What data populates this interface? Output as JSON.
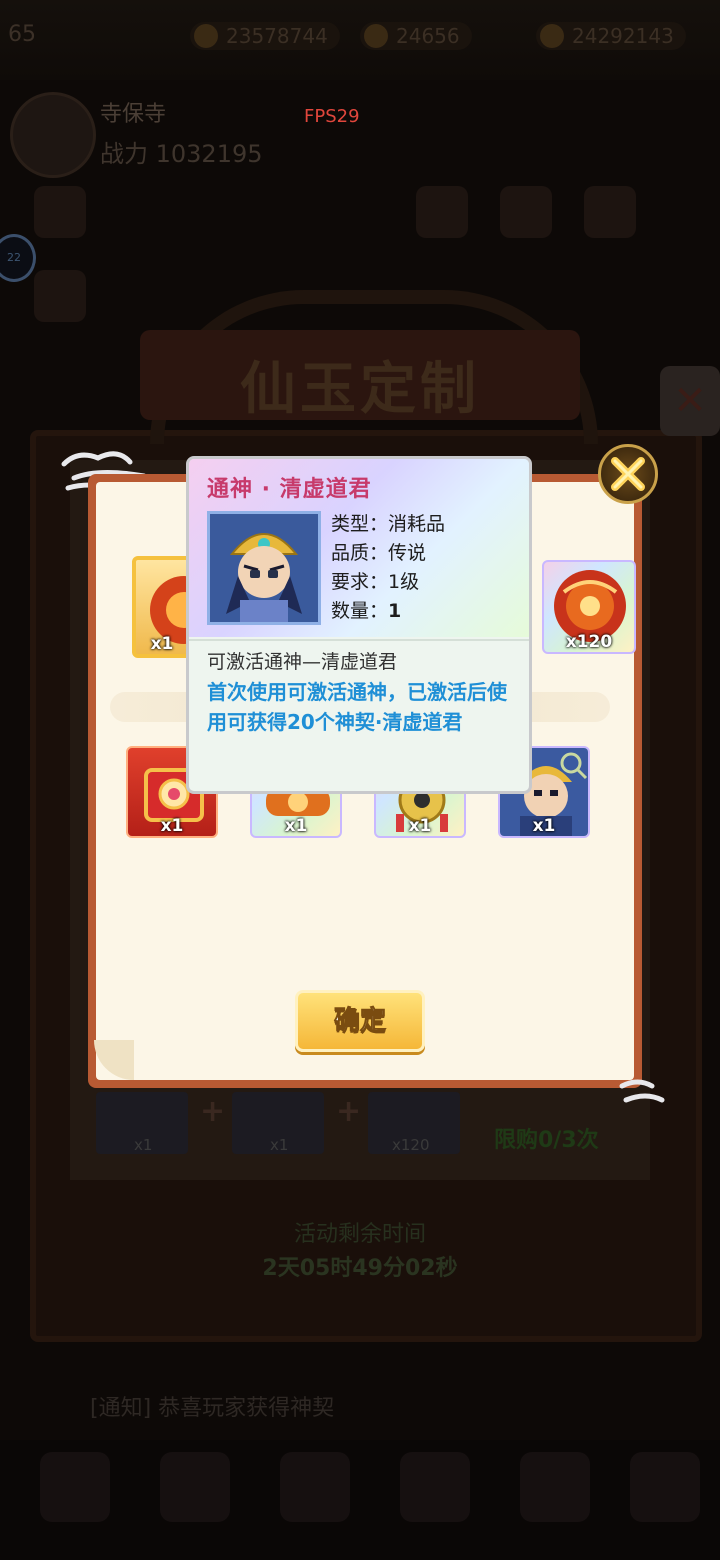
{
  "hud": {
    "level": "65",
    "currency": [
      "23578744",
      "24656",
      "24292143"
    ],
    "player_name": "寺保寺",
    "player_power": "战力 1032195",
    "fps": "FPS29",
    "side_badge": "22"
  },
  "background": {
    "event_title": "仙玉定制",
    "close_glyph": "✕",
    "purchase_limit": "限购0/3次",
    "remaining_label": "活动剩余时间",
    "remaining_time": "2天05时49分02秒",
    "bottom_slots": [
      "x1",
      "x1",
      "x120"
    ],
    "ticker": "[通知] 恭喜玩家获得神契"
  },
  "reward_panel": {
    "top_items": [
      {
        "icon": "selected-reward-icon",
        "qty": "x1"
      },
      {
        "icon": "fire-orb-icon",
        "qty": "x120"
      }
    ],
    "bottom_items": [
      {
        "icon": "red-gift-box-icon",
        "qty": "x1"
      },
      {
        "icon": "fire-scroll-icon",
        "qty": "x1"
      },
      {
        "icon": "golden-ornament-icon",
        "qty": "x1"
      },
      {
        "icon": "hero-portrait-icon",
        "qty": "x1"
      }
    ],
    "confirm_label": "确定"
  },
  "tooltip": {
    "title": "通神 · 清虚道君",
    "type_label": "类型：",
    "type_value": "消耗品",
    "quality_label": "品质：",
    "quality_value": "传说",
    "req_label": "要求：",
    "req_value": "1级",
    "count_label": "数量：",
    "count_value": "1",
    "desc_plain": "可激活通神—清虚道君",
    "desc_effect": "首次使用可激活通神，已激活后使用可获得20个神契·清虚道君"
  },
  "colors": {
    "title_pink": "#c73a6b",
    "effect_blue": "#1f8fd6",
    "confirm_gold": "#f5b738",
    "scroll_red": "#b85a33"
  }
}
